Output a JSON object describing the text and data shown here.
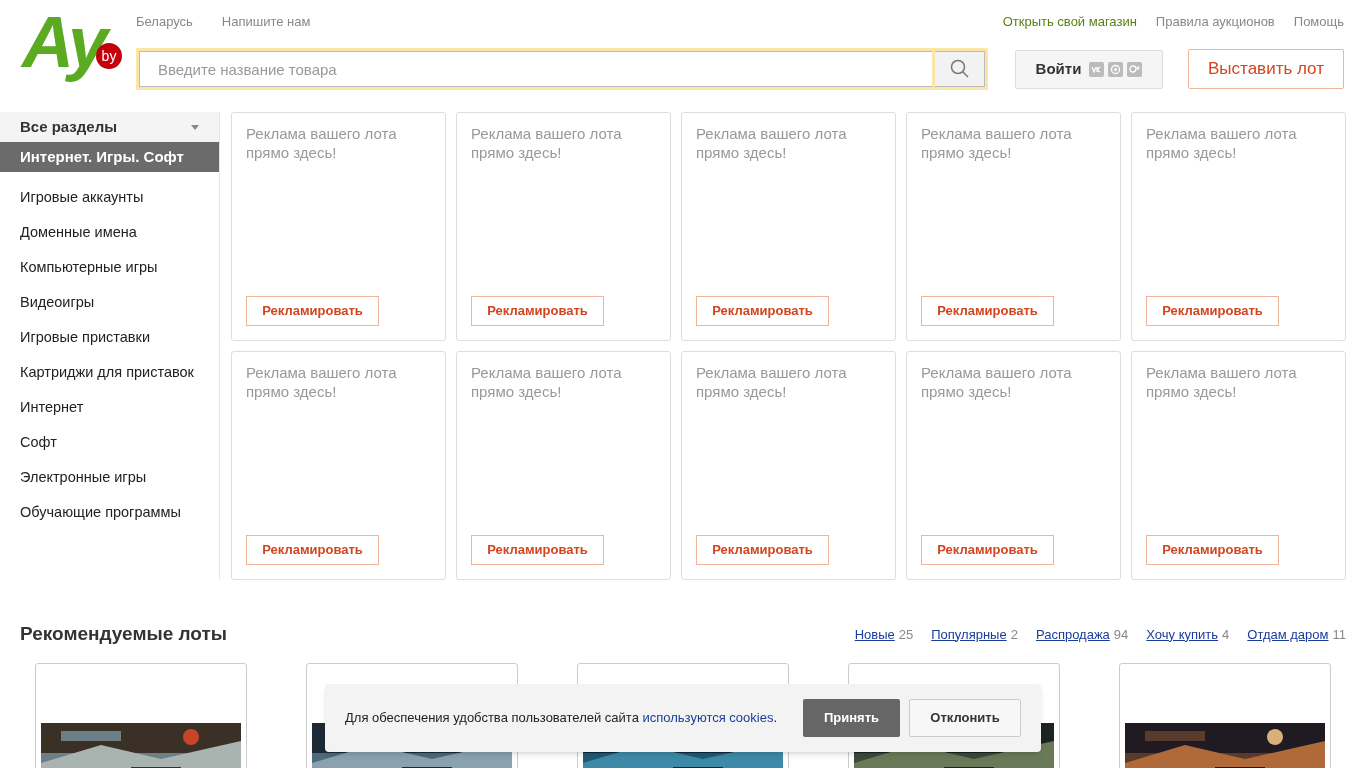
{
  "logo": {
    "text": "Ay",
    "badge": "by"
  },
  "top_links": [
    "Беларусь",
    "Напишите нам"
  ],
  "top_right_links": [
    {
      "label": "Открыть свой магазин",
      "kind": "accent"
    },
    {
      "label": "Правила аукционов",
      "kind": "plain"
    },
    {
      "label": "Помощь",
      "kind": "plain"
    }
  ],
  "search": {
    "placeholder": "Введите название товара"
  },
  "login": {
    "label": "Войти"
  },
  "sell_button": "Выставить лот",
  "sidebar": {
    "header": "Все разделы",
    "items": [
      {
        "label": "Интернет. Игры. Софт",
        "selected": true
      },
      {
        "label": "Игровые аккаунты",
        "selected": false
      },
      {
        "label": "Доменные имена",
        "selected": false
      },
      {
        "label": "Компьютерные игры",
        "selected": false
      },
      {
        "label": "Видеоигры",
        "selected": false
      },
      {
        "label": "Игровые приставки",
        "selected": false
      },
      {
        "label": "Картриджи для приставок",
        "selected": false
      },
      {
        "label": "Интернет",
        "selected": false
      },
      {
        "label": "Софт",
        "selected": false
      },
      {
        "label": "Электронные игры",
        "selected": false
      },
      {
        "label": "Обучающие программы",
        "selected": false
      }
    ]
  },
  "ad_cards": [
    {
      "text": "Реклама вашего лота прямо здесь!",
      "button": "Рекламировать"
    },
    {
      "text": "Реклама вашего лота прямо здесь!",
      "button": "Рекламировать"
    },
    {
      "text": "Реклама вашего лота прямо здесь!",
      "button": "Рекламировать"
    },
    {
      "text": "Реклама вашего лота прямо здесь!",
      "button": "Рекламировать"
    },
    {
      "text": "Реклама вашего лота прямо здесь!",
      "button": "Рекламировать"
    },
    {
      "text": "Реклама вашего лота прямо здесь!",
      "button": "Рекламировать"
    },
    {
      "text": "Реклама вашего лота прямо здесь!",
      "button": "Рекламировать"
    },
    {
      "text": "Реклама вашего лота прямо здесь!",
      "button": "Рекламировать"
    },
    {
      "text": "Реклама вашего лота прямо здесь!",
      "button": "Рекламировать"
    },
    {
      "text": "Реклама вашего лота прямо здесь!",
      "button": "Рекламировать"
    }
  ],
  "recommended": {
    "title": "Рекомендуемые лоты",
    "filters": [
      {
        "label": "Новые",
        "count": "25"
      },
      {
        "label": "Популярные",
        "count": "2"
      },
      {
        "label": "Распродажа",
        "count": "94"
      },
      {
        "label": "Хочу купить",
        "count": "4"
      },
      {
        "label": "Отдам даром",
        "count": "11"
      }
    ]
  },
  "cookie_banner": {
    "text": "Для обеспечения удобства пользователей сайта ",
    "link": "используются cookies",
    "tail": ".",
    "accept": "Принять",
    "decline": "Отклонить"
  }
}
